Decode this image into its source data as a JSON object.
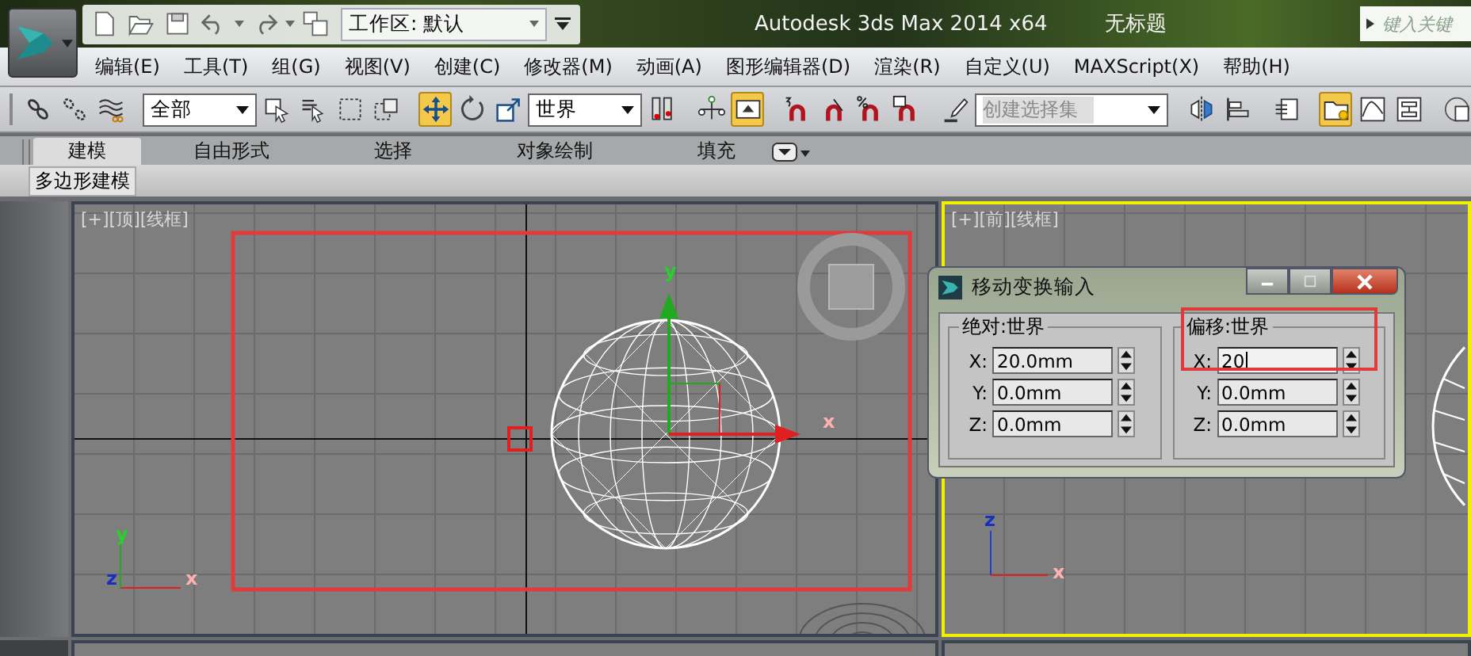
{
  "app_title": "Autodesk 3ds Max  2014 x64",
  "document_title": "无标题",
  "quick_access": {
    "tools": [
      {
        "kind": "new-page"
      },
      {
        "kind": "open-folder"
      },
      {
        "kind": "save-disk"
      },
      {
        "kind": "undo"
      },
      {
        "kind": "redo"
      },
      {
        "kind": "project-folder"
      }
    ],
    "workspace": "工作区: 默认"
  },
  "search": {
    "placeholder": "键入关键"
  },
  "menu": [
    "编辑(E)",
    "工具(T)",
    "组(G)",
    "视图(V)",
    "创建(C)",
    "修改器(M)",
    "动画(A)",
    "图形编辑器(D)",
    "渲染(R)",
    "自定义(U)",
    "MAXScript(X)",
    "帮助(H)"
  ],
  "toolbar": {
    "groups": [
      [
        {
          "kind": "chain-link",
          "active": false
        },
        {
          "kind": "broken-link",
          "active": false
        },
        {
          "kind": "wave",
          "active": false
        }
      ],
      [
        {
          "kind": "dropdown",
          "value": "全部"
        },
        {
          "kind": "cursor-box",
          "active": false
        },
        {
          "kind": "list-cursor",
          "active": false
        },
        {
          "kind": "dashed-rect",
          "active": false
        },
        {
          "kind": "dashed-squares",
          "active": false
        }
      ],
      [
        {
          "kind": "move-arrows",
          "active": true
        },
        {
          "kind": "rotate",
          "active": false
        },
        {
          "kind": "scale",
          "active": false
        },
        {
          "kind": "dropdown",
          "value": "世界"
        },
        {
          "kind": "pivot",
          "active": false
        }
      ],
      [
        {
          "kind": "node-axes",
          "active": false
        },
        {
          "kind": "keyboard-box",
          "active": true
        }
      ],
      [
        {
          "kind": "magnet-3",
          "active": false
        },
        {
          "kind": "magnet-angle",
          "active": false
        },
        {
          "kind": "magnet-percent",
          "active": false
        },
        {
          "kind": "magnet-spinner",
          "active": false
        }
      ],
      [
        {
          "kind": "pencil-abc",
          "active": false
        },
        {
          "kind": "combo",
          "placeholder": "创建选择集"
        }
      ],
      [
        {
          "kind": "mirror",
          "active": false
        },
        {
          "kind": "align",
          "active": false
        }
      ],
      [
        {
          "kind": "layers",
          "active": false
        }
      ],
      [
        {
          "kind": "folder-bulb",
          "active": true
        },
        {
          "kind": "curve-editor",
          "active": false
        },
        {
          "kind": "schematic",
          "active": false
        }
      ],
      [
        {
          "kind": "teapot-disc",
          "active": false
        }
      ]
    ]
  },
  "ribbon": {
    "tabs": [
      {
        "label": "建模",
        "selected": true
      },
      {
        "label": "自由形式",
        "selected": false
      },
      {
        "label": "选择",
        "selected": false
      },
      {
        "label": "对象绘制",
        "selected": false
      },
      {
        "label": "填充",
        "selected": false
      }
    ],
    "panel": "多边形建模"
  },
  "viewports": [
    {
      "kind": "top",
      "label": "[+][顶][线框]",
      "active": false,
      "gizmo": [
        "y",
        "x"
      ],
      "axis_triad": [
        "y",
        "z",
        "x"
      ]
    },
    {
      "kind": "front",
      "label": "[+][前][线框]",
      "active": true,
      "axis_triad": [
        "z",
        "x"
      ]
    }
  ],
  "dialog": {
    "title": "移动变换输入",
    "groups": [
      {
        "title": "绝对:世界",
        "fields": [
          {
            "label": "X:",
            "value": "20.0mm",
            "focused": false
          },
          {
            "label": "Y:",
            "value": "0.0mm",
            "focused": false
          },
          {
            "label": "Z:",
            "value": "0.0mm",
            "focused": false
          }
        ]
      },
      {
        "title": "偏移:世界",
        "fields": [
          {
            "label": "X:",
            "value": "20",
            "focused": true
          },
          {
            "label": "Y:",
            "value": "0.0mm",
            "focused": false
          },
          {
            "label": "Z:",
            "value": "0.0mm",
            "focused": false
          }
        ]
      }
    ]
  }
}
